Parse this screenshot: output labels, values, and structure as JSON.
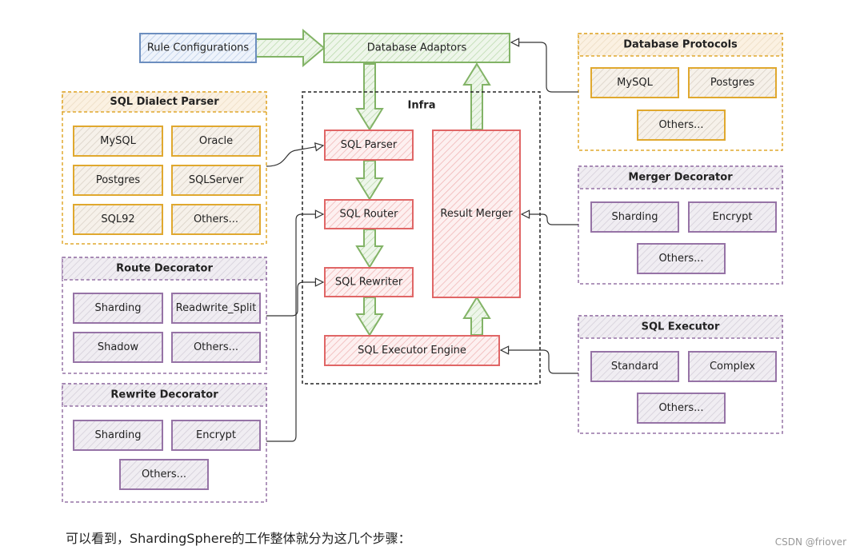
{
  "colors": {
    "blue": "#6c8ebf",
    "green": "#82b366",
    "red": "#e06666",
    "orange": "#e0a82e",
    "purple": "#9673a6"
  },
  "diagram": {
    "rule_configurations": "Rule Configurations",
    "database_adaptors": "Database Adaptors",
    "infra": {
      "label": "Infra",
      "sql_parser": "SQL Parser",
      "sql_router": "SQL Router",
      "sql_rewriter": "SQL Rewriter",
      "sql_executor_engine": "SQL Executor Engine",
      "result_merger": "Result Merger"
    },
    "sql_dialect_parser": {
      "title": "SQL Dialect Parser",
      "items": [
        "MySQL",
        "Oracle",
        "Postgres",
        "SQLServer",
        "SQL92",
        "Others..."
      ]
    },
    "route_decorator": {
      "title": "Route Decorator",
      "items": [
        "Sharding",
        "Readwrite_Split",
        "Shadow",
        "Others..."
      ]
    },
    "rewrite_decorator": {
      "title": "Rewrite Decorator",
      "items": [
        "Sharding",
        "Encrypt",
        "Others..."
      ]
    },
    "database_protocols": {
      "title": "Database Protocols",
      "items": [
        "MySQL",
        "Postgres",
        "Others..."
      ]
    },
    "merger_decorator": {
      "title": "Merger Decorator",
      "items": [
        "Sharding",
        "Encrypt",
        "Others..."
      ]
    },
    "sql_executor": {
      "title": "SQL Executor",
      "items": [
        "Standard",
        "Complex",
        "Others..."
      ]
    }
  },
  "caption": "可以看到，ShardingSphere的工作整体就分为这几个步骤：",
  "watermark": "CSDN @friover"
}
